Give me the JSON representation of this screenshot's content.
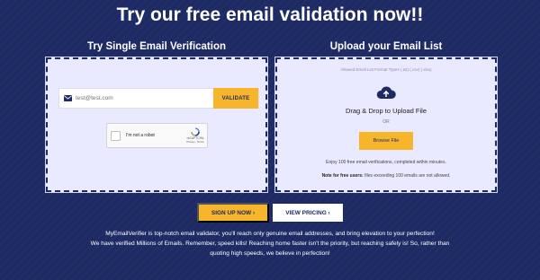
{
  "hero": {
    "title": "Try our free email validation now!!"
  },
  "single": {
    "title": "Try Single Email Verification",
    "email_placeholder": "test@test.com",
    "validate_label": "VALIDATE",
    "captcha": {
      "label": "I'm not a robot",
      "brand": "reCAPTCHA",
      "links": "Privacy - Terms"
    }
  },
  "upload": {
    "title": "Upload your Email List",
    "allowed_types": "Allowed Email List Format Types (.txt) (.csv) (.xlsx)",
    "drag_text": "Drag & Drop to Upload File",
    "or_text": "OR",
    "browse_label": "Browse File",
    "enjoy_text": "Enjoy 100 free email verifications, completed within minutes.",
    "note_label": "Note for free users:",
    "note_text": "files exceeding 100 emails are not allowed."
  },
  "cta": {
    "signup_label": "SIGN UP NOW ›",
    "pricing_label": "VIEW PRICING ›"
  },
  "description": {
    "line1": "MyEmailVerifier is top-notch email validator, you'll reach only genuine email addresses, and bring elevation to your perfection!",
    "line2": "We have verified Millions of Emails. Remember, speed kills! Reaching home faster isn't the priority, but reaching safely is! So, rather than",
    "line3": "quoting high speeds, we believe in perfection!"
  },
  "colors": {
    "background": "#1d2a63",
    "accent": "#f7b52c",
    "card": "#e9e9ff"
  },
  "icons": [
    "envelope-icon",
    "cloud-upload-icon",
    "recaptcha-icon"
  ]
}
